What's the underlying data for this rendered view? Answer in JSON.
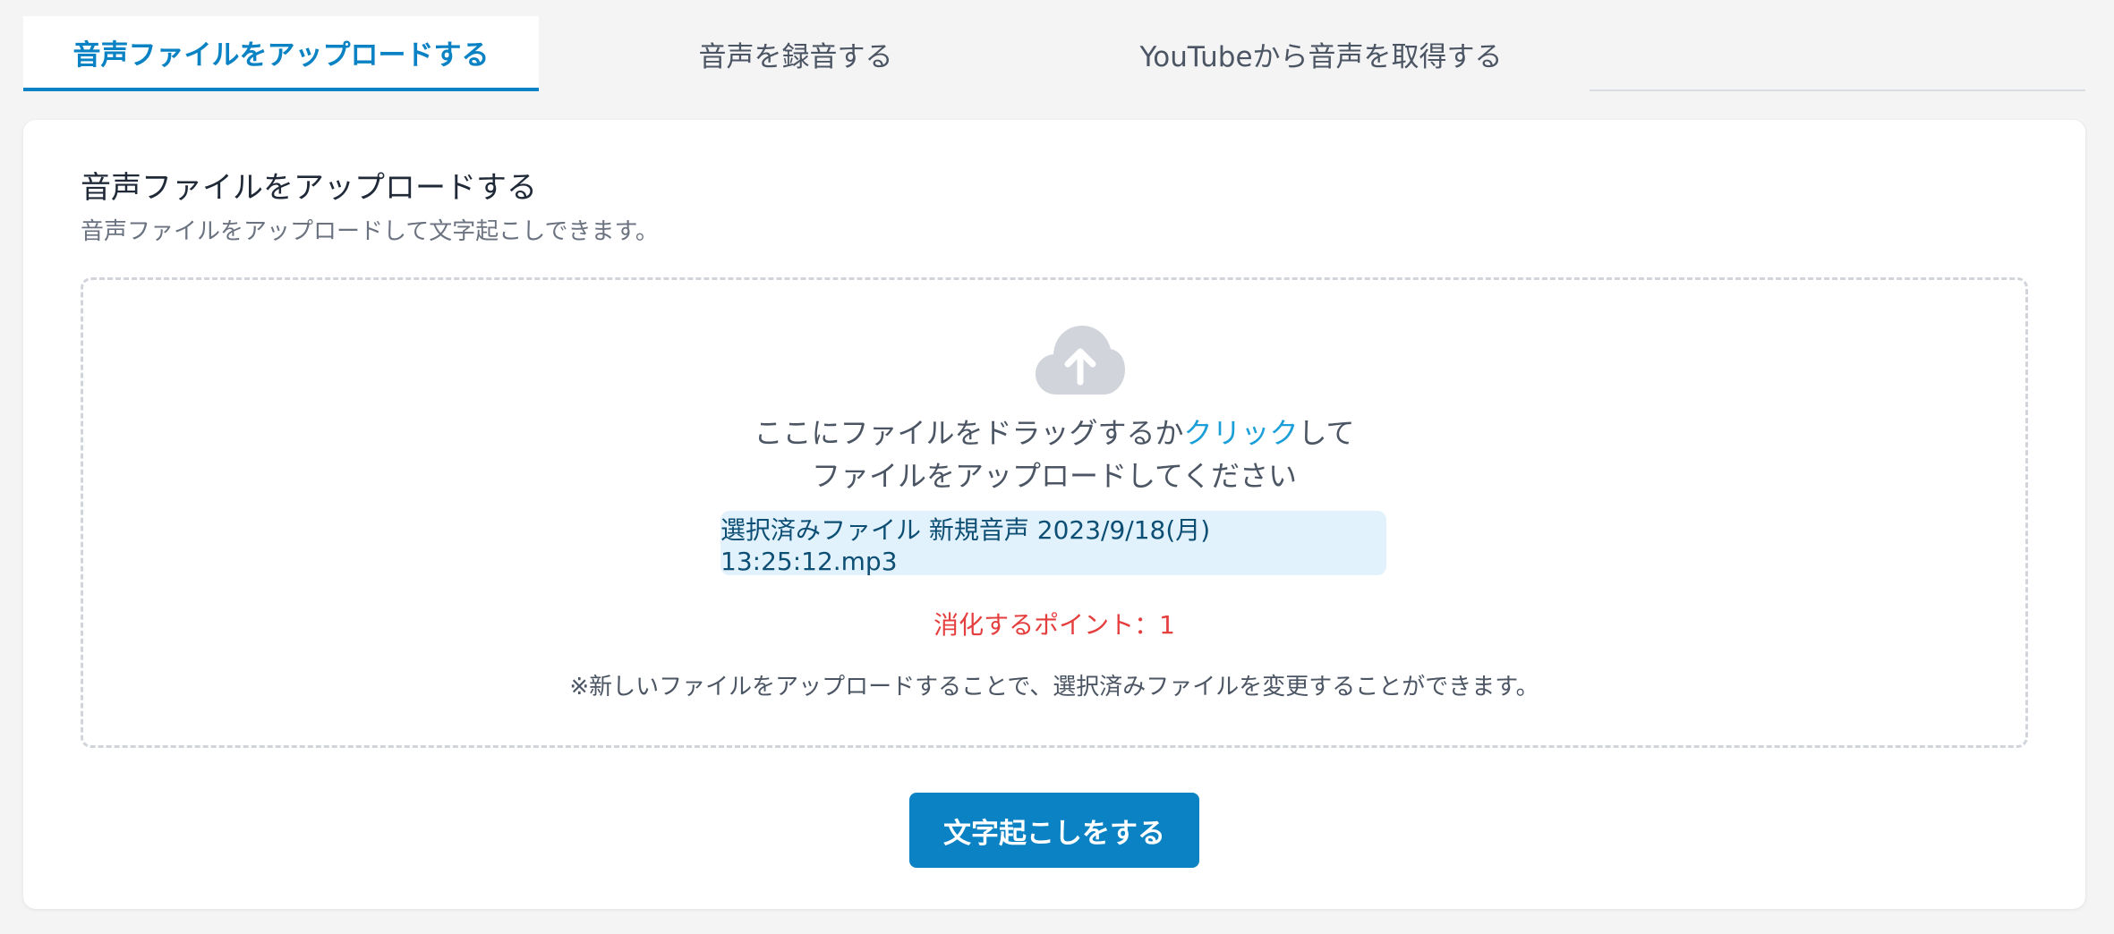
{
  "tabs": [
    {
      "label": "音声ファイルをアップロードする",
      "active": true
    },
    {
      "label": "音声を録音する",
      "active": false
    },
    {
      "label": "YouTubeから音声を取得する",
      "active": false
    }
  ],
  "card": {
    "title": "音声ファイルをアップロードする",
    "subtitle": "音声ファイルをアップロードして文字起こしできます。"
  },
  "dropzone": {
    "icon": "cloud-upload-icon",
    "line1_before": "ここにファイルをドラッグするか",
    "line1_link": "クリック",
    "line1_after": "して",
    "line2": "ファイルをアップロードしてください",
    "selected_file": "選択済みファイル 新規音声 2023/9/18(月) 13:25:12.mp3",
    "points": "消化するポイント：1",
    "note": "※新しいファイルをアップロードすることで、選択済みファイルを変更することができます。"
  },
  "submit_label": "文字起こしをする",
  "colors": {
    "accent": "#0a82c3",
    "link": "#1a9fd8",
    "warning": "#e53e3e",
    "file_chip_bg": "#e1f2fc"
  }
}
